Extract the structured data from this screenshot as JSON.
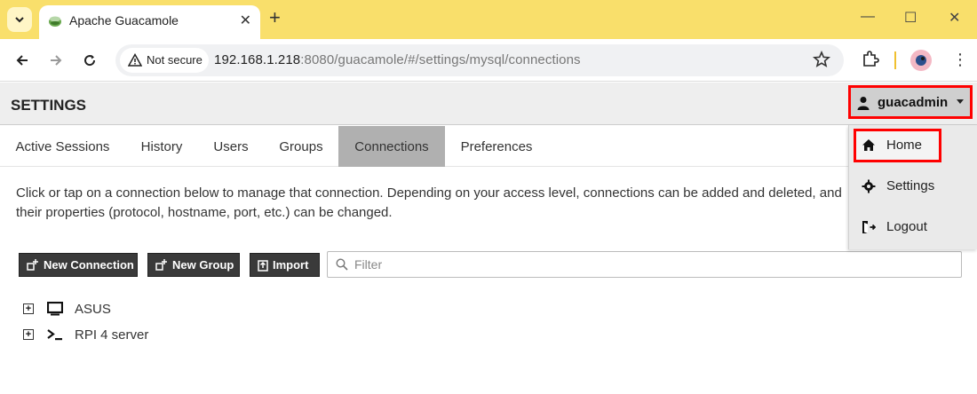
{
  "browser": {
    "tab_title": "Apache Guacamole",
    "close_symbol": "✕",
    "new_tab_symbol": "+",
    "security_label": "Not secure",
    "url_host": "192.168.1.218",
    "url_rest": ":8080/guacamole/#/settings/mysql/connections",
    "window_controls": {
      "minimize": "—",
      "maximize": "☐",
      "close": "✕"
    },
    "menu_symbol": "⋮"
  },
  "header": {
    "title": "SETTINGS",
    "user": "guacadmin"
  },
  "tabs": [
    {
      "label": "Active Sessions"
    },
    {
      "label": "History"
    },
    {
      "label": "Users"
    },
    {
      "label": "Groups"
    },
    {
      "label": "Connections",
      "active": true
    },
    {
      "label": "Preferences"
    }
  ],
  "description": "Click or tap on a connection below to manage that connection. Depending on your access level, connections can be added and deleted, and their properties (protocol, hostname, port, etc.) can be changed.",
  "actions": {
    "new_connection": "New Connection",
    "new_group": "New Group",
    "import": "Import",
    "filter_placeholder": "Filter"
  },
  "connections": [
    {
      "label": "ASUS",
      "icon": "monitor-icon",
      "expander": "+"
    },
    {
      "label": "RPI 4 server",
      "icon": "terminal-icon",
      "expander": "+"
    }
  ],
  "user_menu": {
    "items": [
      {
        "label": "Home",
        "icon": "home-icon"
      },
      {
        "label": "Settings",
        "icon": "gear-icon"
      },
      {
        "label": "Logout",
        "icon": "logout-icon"
      }
    ]
  },
  "colors": {
    "browser_frame": "#f9df6b",
    "highlight": "#ff0000",
    "active_tab": "#b0b0b0",
    "button_bg": "#3a3a3a"
  }
}
